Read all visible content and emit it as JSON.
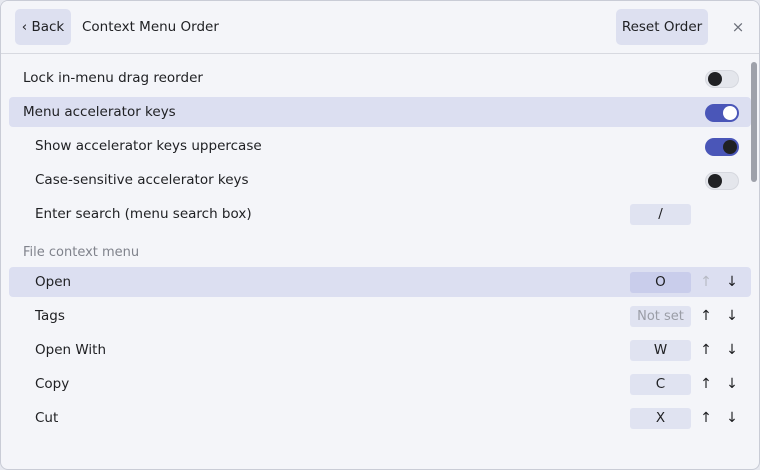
{
  "header": {
    "back_label": "‹ Back",
    "title": "Context Menu Order",
    "reset_label": "Reset Order",
    "close_glyph": "×"
  },
  "settings": [
    {
      "label": "Lock in-menu drag reorder",
      "state": "off"
    },
    {
      "label": "Menu accelerator keys",
      "state": "on"
    },
    {
      "label": "Show accelerator keys uppercase",
      "state": "on"
    },
    {
      "label": "Case-sensitive accelerator keys",
      "state": "off"
    },
    {
      "label": "Enter search (menu search box)",
      "key": "/"
    }
  ],
  "section": {
    "title": "File context menu",
    "items": [
      {
        "label": "Open",
        "key": "O",
        "up": "↑",
        "down": "↓"
      },
      {
        "label": "Tags",
        "key": "Not set",
        "up": "↑",
        "down": "↓"
      },
      {
        "label": "Open With",
        "key": "W",
        "up": "↑",
        "down": "↓"
      },
      {
        "label": "Copy",
        "key": "C",
        "up": "↑",
        "down": "↓"
      },
      {
        "label": "Cut",
        "key": "X",
        "up": "↑",
        "down": "↓"
      }
    ]
  },
  "colors": {
    "accent": "#4a56b8",
    "highlight": "#dcdff1",
    "background": "#f4f5f9"
  }
}
